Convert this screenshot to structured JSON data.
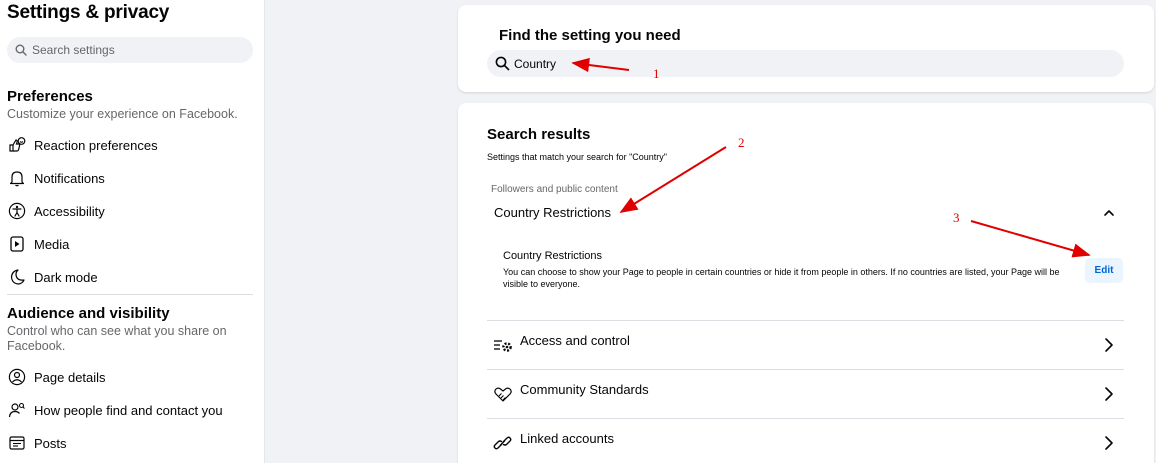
{
  "sidebar": {
    "title": "Settings & privacy",
    "search_placeholder": "Search settings",
    "preferences": {
      "title": "Preferences",
      "subtitle": "Customize your experience on Facebook.",
      "items": [
        {
          "label": "Reaction preferences",
          "icon": "reaction-icon"
        },
        {
          "label": "Notifications",
          "icon": "bell-icon"
        },
        {
          "label": "Accessibility",
          "icon": "accessibility-icon"
        },
        {
          "label": "Media",
          "icon": "media-icon"
        },
        {
          "label": "Dark mode",
          "icon": "moon-icon"
        }
      ]
    },
    "audience": {
      "title": "Audience and visibility",
      "subtitle_line1": "Control who can see what you share on",
      "subtitle_line2": "Facebook.",
      "items": [
        {
          "label": "Page details",
          "icon": "person-icon"
        },
        {
          "label": "How people find and contact you",
          "icon": "person-search-icon"
        },
        {
          "label": "Posts",
          "icon": "posts-icon"
        }
      ]
    }
  },
  "find": {
    "title": "Find the setting you need",
    "search_value": "Country"
  },
  "results": {
    "title": "Search results",
    "subtitle": "Settings that match your search for \"Country\"",
    "group_label": "Followers and public content",
    "group_title": "Country Restrictions",
    "item_title": "Country Restrictions",
    "item_desc": "You can choose to show your Page to people in certain countries or hide it from people in others. If no countries are listed, your Page will be visible to everyone.",
    "edit_label": "Edit",
    "rows": [
      {
        "label": "Access and control",
        "icon": "access-control-icon"
      },
      {
        "label": "Community Standards",
        "icon": "handshake-icon"
      },
      {
        "label": "Linked accounts",
        "icon": "link-icon"
      }
    ]
  },
  "annotations": {
    "n1": "1",
    "n2": "2",
    "n3": "3",
    "color": "#e00000"
  },
  "colors": {
    "accent": "#0064d1",
    "edit_bg": "#ebf5ff",
    "page_bg": "#f0f2f5"
  }
}
